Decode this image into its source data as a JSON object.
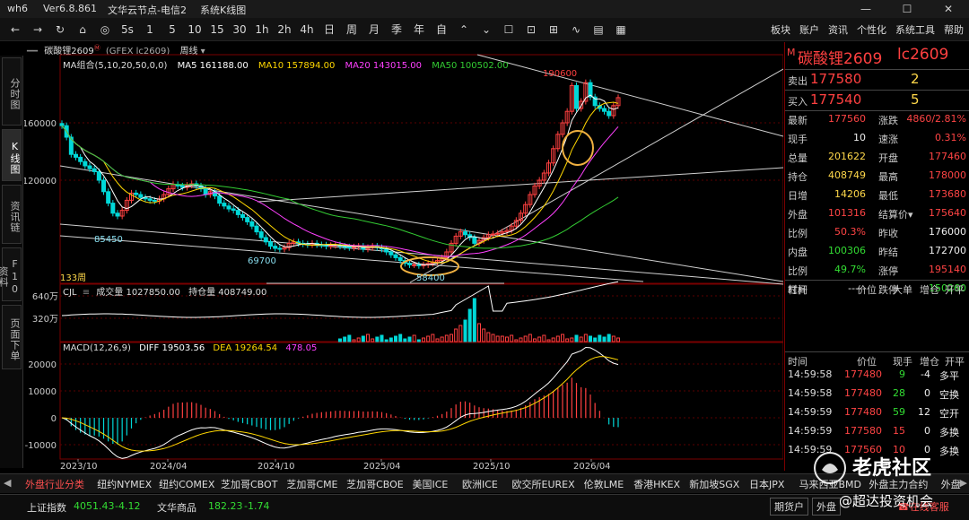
{
  "titlebar": {
    "app": "wh6",
    "version": "Ver6.8.861",
    "server": "文华云节点-电信2",
    "mode": "系统K线图"
  },
  "toolbar": {
    "left_buttons": [
      "←",
      "→",
      "↻",
      "⌂",
      "◎",
      "5s",
      "1",
      "5",
      "10",
      "15",
      "30",
      "1h",
      "2h",
      "4h",
      "日",
      "周",
      "月",
      "季",
      "年",
      "自",
      "⌃",
      "⌄",
      "☐",
      "⊡",
      "⊞",
      "∿",
      "▤",
      "▦"
    ],
    "right_buttons": [
      "板块",
      "账户",
      "资讯",
      "个性化",
      "系统工具",
      "帮助"
    ]
  },
  "sidetabs": [
    {
      "label": "分时图",
      "active": false
    },
    {
      "label": "K线图",
      "active": true
    },
    {
      "label": "资讯链",
      "active": false
    },
    {
      "label": "F10资料",
      "active": false
    },
    {
      "label": "页面下单",
      "active": false
    }
  ],
  "chart_header": {
    "name": "碳酸锂2609",
    "sup": "Ⓜ",
    "code": "(GFEX lc2609)",
    "period": "周线"
  },
  "ma": {
    "label": "MA组合(5,10,20,50,0,0)",
    "ma5": "MA5 161188.00",
    "ma10": "MA10 157894.00",
    "ma20": "MA20 143015.00",
    "ma50": "MA50 100502.00"
  },
  "price_axis": [
    "160000",
    "120000"
  ],
  "annotations": {
    "high": "190600",
    "low1": "85450",
    "low2": "69700",
    "low3": "58400",
    "periods": "133周"
  },
  "vol": {
    "label": "CJL",
    "vol": "成交量 1027850.00",
    "oi": "持仓量 408749.00",
    "axis": [
      "640万",
      "320万"
    ]
  },
  "macd": {
    "label": "MACD(12,26,9)",
    "diff": "DIFF 19503.56",
    "dea": "DEA 19264.54",
    "macd": "478.05",
    "axis": [
      "20000",
      "10000",
      "0",
      "-10000"
    ]
  },
  "dates": [
    "2023/10",
    "2024/04",
    "2024/10",
    "2025/04",
    "2025/10",
    "2026/04"
  ],
  "quote": {
    "title": "碳酸锂2609",
    "code": "lc2609",
    "ask_label": "卖出",
    "ask": "177580",
    "ask_vol": "2",
    "bid_label": "买入",
    "bid": "177540",
    "bid_vol": "5",
    "rows": [
      {
        "l1": "最新",
        "v1": "177560",
        "c1": "red",
        "l2": "涨跌",
        "v2": "4860/2.81%",
        "c2": "red"
      },
      {
        "l1": "现手",
        "v1": "10",
        "c1": "white",
        "l2": "速涨",
        "v2": "0.31%",
        "c2": "red"
      },
      {
        "l1": "总量",
        "v1": "201622",
        "c1": "yellow",
        "l2": "开盘",
        "v2": "177460",
        "c2": "red"
      },
      {
        "l1": "持仓",
        "v1": "408749",
        "c1": "yellow",
        "l2": "最高",
        "v2": "178000",
        "c2": "red"
      },
      {
        "l1": "日增",
        "v1": "14206",
        "c1": "yellow",
        "l2": "最低",
        "v2": "173680",
        "c2": "red"
      },
      {
        "l1": "外盘",
        "v1": "101316",
        "c1": "red",
        "l2": "结算价▾",
        "v2": "175640",
        "c2": "red"
      },
      {
        "l1": "比例",
        "v1": "50.3%",
        "c1": "red",
        "l2": "昨收",
        "v2": "176000",
        "c2": "white"
      },
      {
        "l1": "内盘",
        "v1": "100306",
        "c1": "green",
        "l2": "昨结",
        "v2": "172700",
        "c2": "white"
      },
      {
        "l1": "比例",
        "v1": "49.7%",
        "c1": "green",
        "l2": "涨停",
        "v2": "195140",
        "c2": "red"
      },
      {
        "l1": "杠杆",
        "v1": "-----",
        "c1": "white",
        "l2": "跌停",
        "v2": "150260",
        "c2": "green"
      }
    ],
    "tick_header": [
      "时间",
      "价位",
      "大单",
      "增仓",
      "开平"
    ],
    "tick_header2": [
      "时间",
      "价位",
      "现手",
      "增仓",
      "开平"
    ],
    "ticks": [
      {
        "t": "14:59:58",
        "p": "177480",
        "n": "9",
        "d": "-4",
        "k": "多平"
      },
      {
        "t": "14:59:58",
        "p": "177480",
        "n": "28",
        "d": "0",
        "k": "空换"
      },
      {
        "t": "14:59:59",
        "p": "177480",
        "n": "59",
        "d": "12",
        "k": "空开"
      },
      {
        "t": "14:59:59",
        "p": "177580",
        "n": "15",
        "d": "0",
        "k": "多换"
      },
      {
        "t": "14:59:59",
        "p": "177560",
        "n": "10",
        "d": "0",
        "k": "多换"
      }
    ]
  },
  "bottom_tabs": [
    "外盘行业分类",
    "纽约NYMEX",
    "纽约COMEX",
    "芝加哥CBOT",
    "芝加哥CME",
    "芝加哥CBOE",
    "美国ICE",
    "欧洲ICE",
    "欧交所EUREX",
    "伦敦LME",
    "香港HKEX",
    "新加坡SGX",
    "日本JPX",
    "马来西亚BMD",
    "外盘主力合约",
    "外盘"
  ],
  "status": {
    "idx1_name": "上证指数",
    "idx1_val": "4051.43",
    "idx1_chg": "-4.12",
    "idx2_name": "文华商品",
    "idx2_val": "182.23",
    "idx2_chg": "-1.74",
    "btn1": "期货户",
    "btn2": "外盘",
    "service": "在线客服"
  },
  "watermark": {
    "brand": "老虎社区",
    "sub": "@超达投资机会"
  },
  "colors": {
    "up": "#ff4040",
    "down": "#00d8d8",
    "ma5": "#ffffff",
    "ma10": "#ffd700",
    "ma20": "#ff40ff",
    "ma50": "#33cc33",
    "bg": "#000000"
  }
}
